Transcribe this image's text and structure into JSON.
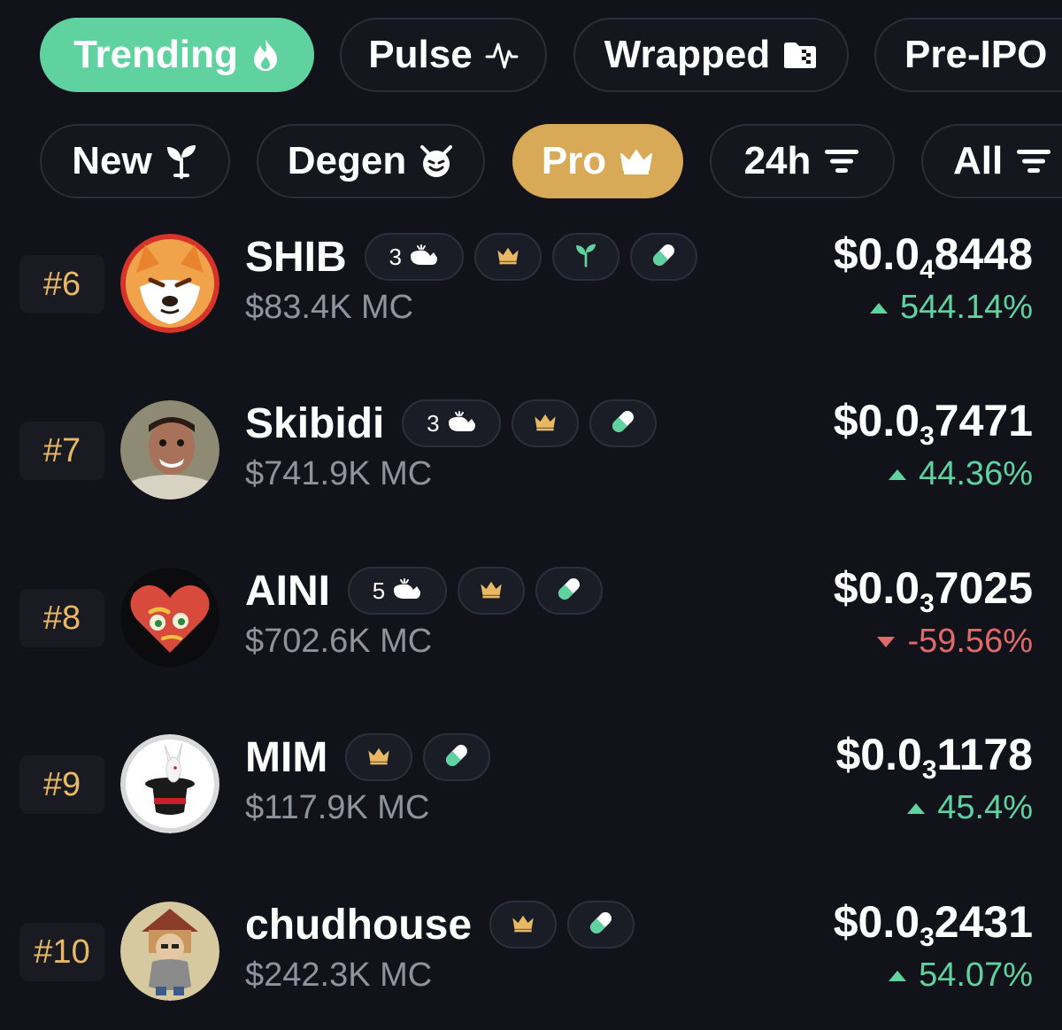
{
  "filters_row1": [
    {
      "label": "Trending",
      "icon": "flame-icon",
      "active": true
    },
    {
      "label": "Pulse",
      "icon": "pulse-icon",
      "active": false
    },
    {
      "label": "Wrapped",
      "icon": "wrapped-icon",
      "active": false
    },
    {
      "label": "Pre-IPO",
      "icon": "",
      "active": false
    }
  ],
  "filters_row2": [
    {
      "label": "New",
      "icon": "sprout-icon",
      "active": false
    },
    {
      "label": "Degen",
      "icon": "devil-icon",
      "active": false
    },
    {
      "label": "Pro",
      "icon": "crown-icon",
      "active": true
    },
    {
      "label": "24h",
      "icon": "filter-lines-icon",
      "active": false
    },
    {
      "label": "All",
      "icon": "filter-lines-icon",
      "active": false
    }
  ],
  "colors": {
    "background": "#12131a",
    "accent_green": "#5fd2a0",
    "accent_gold": "#d8a957",
    "down_red": "#e06a6a",
    "rank_text": "#e8b864"
  },
  "tokens": [
    {
      "rank": "#6",
      "name": "SHIB",
      "whale_count": "3",
      "badges": [
        "whale-icon",
        "crown-icon",
        "sprout-icon",
        "pill-icon"
      ],
      "market_cap": "$83.4K MC",
      "price_prefix": "$0.0",
      "price_zeros": "4",
      "price_digits": "8448",
      "change": "544.14%",
      "direction": "up",
      "avatar": "shib-avatar"
    },
    {
      "rank": "#7",
      "name": "Skibidi",
      "whale_count": "3",
      "badges": [
        "whale-icon",
        "crown-icon",
        "pill-icon"
      ],
      "market_cap": "$741.9K MC",
      "price_prefix": "$0.0",
      "price_zeros": "3",
      "price_digits": "7471",
      "change": "44.36%",
      "direction": "up",
      "avatar": "skibidi-avatar"
    },
    {
      "rank": "#8",
      "name": "AINI",
      "whale_count": "5",
      "badges": [
        "whale-icon",
        "crown-icon",
        "pill-icon"
      ],
      "market_cap": "$702.6K MC",
      "price_prefix": "$0.0",
      "price_zeros": "3",
      "price_digits": "7025",
      "change": "-59.56%",
      "direction": "down",
      "avatar": "aini-avatar"
    },
    {
      "rank": "#9",
      "name": "MIM",
      "whale_count": "",
      "badges": [
        "crown-icon",
        "pill-icon"
      ],
      "market_cap": "$117.9K MC",
      "price_prefix": "$0.0",
      "price_zeros": "3",
      "price_digits": "1178",
      "change": "45.4%",
      "direction": "up",
      "avatar": "mim-avatar"
    },
    {
      "rank": "#10",
      "name": "chudhouse",
      "whale_count": "",
      "badges": [
        "crown-icon",
        "pill-icon"
      ],
      "market_cap": "$242.3K MC",
      "price_prefix": "$0.0",
      "price_zeros": "3",
      "price_digits": "2431",
      "change": "54.07%",
      "direction": "up",
      "avatar": "chudhouse-avatar"
    }
  ]
}
